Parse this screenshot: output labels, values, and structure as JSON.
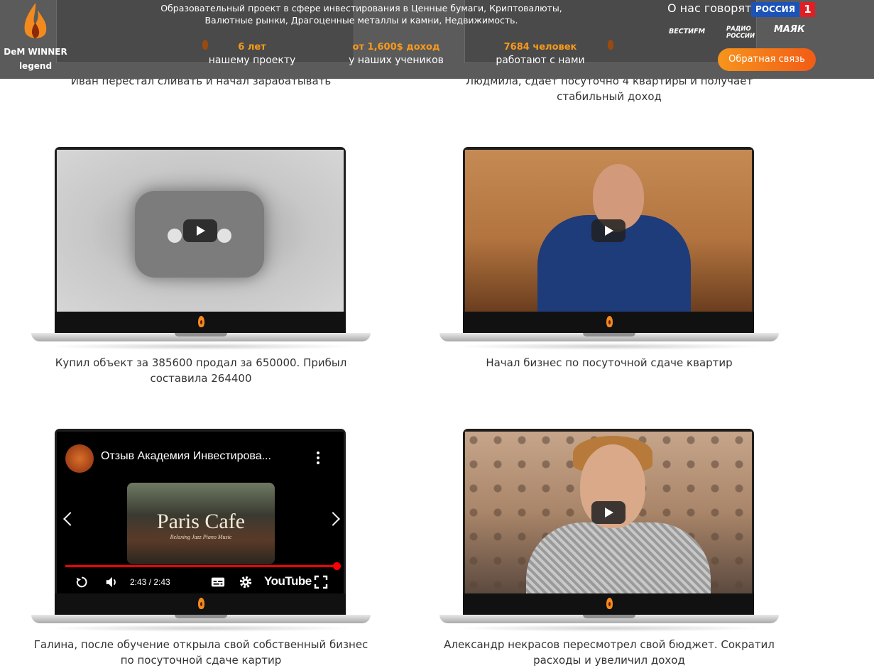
{
  "header": {
    "brand_line1": "DeM WINNER",
    "brand_line2": "legend",
    "tagline": "Образовательный проект в сфере инвестирования в Ценные бумаги, Криптовалюты, Валютные рынки, Драгоценные металлы и камни, Недвижимость.",
    "stats": [
      {
        "value": "6 лет",
        "label": "нашему проекту"
      },
      {
        "value": "от 1,600$ доход",
        "label": "у наших учеников"
      },
      {
        "value": "7684 человек",
        "label": "работают с нами"
      }
    ],
    "press_label": "О нас говорят:",
    "press_logos": {
      "russia": "РОССИЯ",
      "russia_num": "1",
      "vesti": "ВЕСТИFM",
      "radio": "РАДИО РОССИИ",
      "mayak": "МАЯК"
    },
    "feedback_button": "Обратная связь",
    "accent_color": "#f79a1c"
  },
  "testimonials": [
    {
      "caption": "Иван перестал сливать и начал зарабатывать"
    },
    {
      "caption": "Людмила, сдает посуточно 4 квартиры и получает стабильный доход"
    },
    {
      "caption": "Купил объект за 385600 продал за 650000. Прибыл составила 264400",
      "video": "play-button"
    },
    {
      "caption": "Начал бизнес по посуточной сдаче квартир",
      "video": "play-button"
    },
    {
      "caption": "Галина, после обучение открыла свой собственный бизнес по посуточной сдаче картир",
      "video": {
        "title": "Отзыв Академия Инвестирова...",
        "thumbnail_title": "Paris Cafe",
        "thumbnail_subtitle": "Relaxing Jazz Piano Music",
        "time": "2:43 / 2:43",
        "brand": "YouTube",
        "progress": 1.0
      }
    },
    {
      "caption": "Александр некрасов пересмотрел свой бюджет. Сократил расходы и увеличил доход",
      "video": "play-button"
    }
  ]
}
